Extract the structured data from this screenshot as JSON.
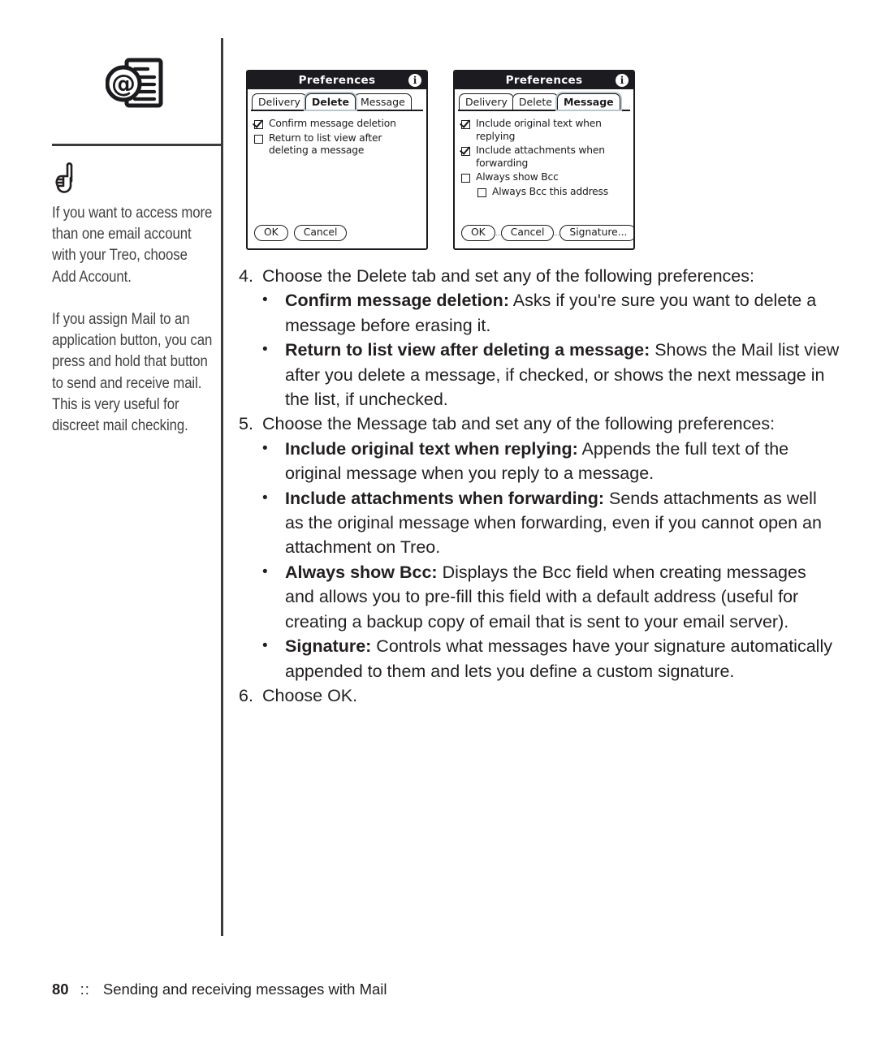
{
  "sidebar": {
    "app_icon": "email-document-icon",
    "tip_icon": "pointing-hand-icon",
    "tips": [
      "If you want to access more than one email account with your Treo, choose Add Account.",
      "If you assign Mail to an application button, you can press and hold that button to send and receive mail. This is very useful for discreet mail checking."
    ]
  },
  "figures": [
    {
      "name": "preferences-delete-dialog",
      "title": "Preferences",
      "info_icon": "info-icon",
      "tabs": [
        {
          "label": "Delivery",
          "selected": false
        },
        {
          "label": "Delete",
          "selected": true
        },
        {
          "label": "Message",
          "selected": false
        }
      ],
      "checkboxes": [
        {
          "label": "Confirm message deletion",
          "checked": true,
          "indent": false
        },
        {
          "label": "Return to list view after deleting a message",
          "checked": false,
          "indent": false
        }
      ],
      "has_separator": false,
      "buttons": [
        "OK",
        "Cancel"
      ]
    },
    {
      "name": "preferences-message-dialog",
      "title": "Preferences",
      "info_icon": "info-icon",
      "tabs": [
        {
          "label": "Delivery",
          "selected": false
        },
        {
          "label": "Delete",
          "selected": false
        },
        {
          "label": "Message",
          "selected": true
        }
      ],
      "checkboxes": [
        {
          "label": "Include original text when replying",
          "checked": true,
          "indent": false
        },
        {
          "label": "Include attachments when forwarding",
          "checked": true,
          "indent": false
        },
        {
          "label": "Always show Bcc",
          "checked": false,
          "indent": false
        },
        {
          "label": "Always Bcc this address",
          "checked": false,
          "indent": true
        }
      ],
      "has_separator": true,
      "buttons": [
        "OK",
        "Cancel",
        "Signature..."
      ]
    }
  ],
  "main": {
    "steps": [
      {
        "number": "4.",
        "text": "Choose the Delete tab and set any of the following preferences:",
        "bullets": [
          {
            "dot": "•",
            "term": "Confirm message deletion:",
            "body": " Asks if you're sure you want to delete a message before erasing it."
          },
          {
            "dot": "•",
            "term": "Return to list view after deleting a message:",
            "body": " Shows the Mail list view after you delete a message, if checked, or shows the next message in the list, if unchecked."
          }
        ]
      },
      {
        "number": "5.",
        "text": "Choose the Message tab and set any of the following preferences:",
        "bullets": [
          {
            "dot": "•",
            "term": "Include original text when replying:",
            "body": " Appends the full text of the original message when you reply to a message."
          },
          {
            "dot": "•",
            "term": "Include attachments when forwarding:",
            "body": " Sends attachments as well as the original message when forwarding, even if you cannot open an attachment on Treo."
          },
          {
            "dot": "•",
            "term": "Always show Bcc:",
            "body": " Displays the Bcc field when creating messages and allows you to pre-fill this field with a default address (useful for creating a backup copy of email that is sent to your email server)."
          },
          {
            "dot": "•",
            "term": "Signature:",
            "body": " Controls what messages have your signature automatically appended to them and lets you define a custom signature."
          }
        ]
      },
      {
        "number": "6.",
        "text": "Choose OK.",
        "bullets": []
      }
    ]
  },
  "footer": {
    "page_number": "80",
    "separator": "::",
    "section_title": "Sending and receiving messages with Mail"
  },
  "colors": {
    "text": "#231f20",
    "rule": "#3b3b3d",
    "dialog_titlebar": "#1b1b20",
    "tab_selected_ring": "#b9c6cc"
  }
}
